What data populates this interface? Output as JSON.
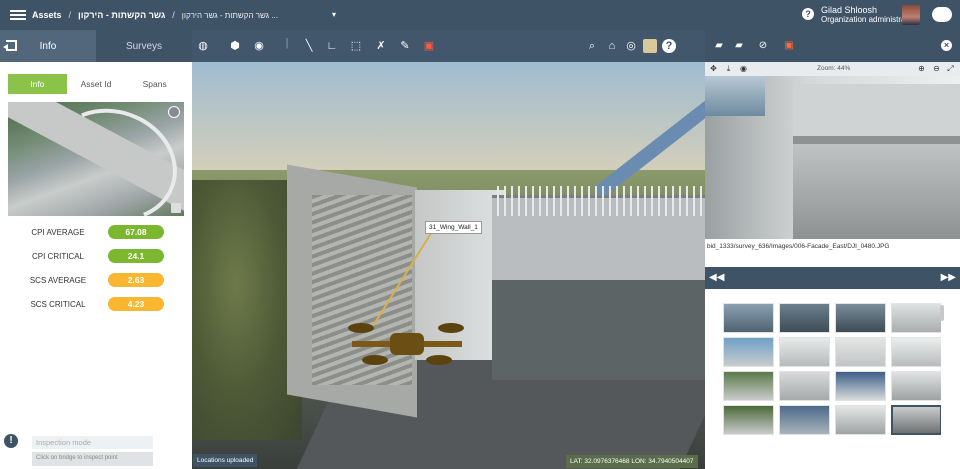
{
  "header": {
    "breadcrumb_root": "Assets",
    "breadcrumb_1": "גשר הקשתות - הירקון",
    "breadcrumb_2": "גשר הקשתות - גשר הירקון ...",
    "user_name": "Gilad Shloosh",
    "user_role": "Organization administrator"
  },
  "left": {
    "tab_info": "Info",
    "tab_surveys": "Surveys",
    "subtabs": [
      "Info",
      "Asset Id",
      "Spans"
    ],
    "metrics": [
      {
        "label": "CPI AVERAGE",
        "value": "67.08",
        "color": "#7cb82f"
      },
      {
        "label": "CPI CRITICAL",
        "value": "24.1",
        "color": "#7cb82f"
      },
      {
        "label": "SCS AVERAGE",
        "value": "2.63",
        "color": "#f7b731"
      },
      {
        "label": "SCS CRITICAL",
        "value": "4.23",
        "color": "#f7b731"
      }
    ],
    "inspection_placeholder": "Inspection mode",
    "inspection_hint": "Click on bridge to inspect point"
  },
  "viewer": {
    "label_tag": "31_Wing_Wall_1",
    "status": "Locations uploaded",
    "lat": "LAT: 32.0976376468",
    "lon": "LON: 34.7940504407"
  },
  "right": {
    "zoom": "Zoom: 44%",
    "image_path": "bid_1333/survey_636/Images/006-Facade_East/DJI_0480.JPG"
  }
}
